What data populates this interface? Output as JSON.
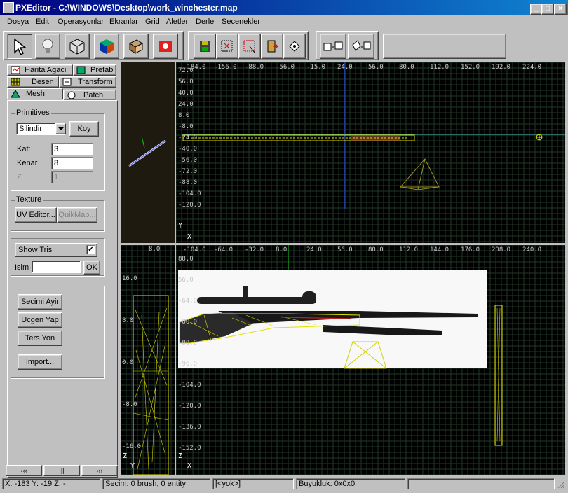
{
  "window": {
    "title": "PXEditor - C:\\WINDOWS\\Desktop\\work_winchester.map",
    "min_label": "_",
    "max_label": "□",
    "close_label": "×"
  },
  "menu": [
    "Dosya",
    "Edit",
    "Operasyonlar",
    "Ekranlar",
    "Grid",
    "Aletler",
    "Derle",
    "Secenekler"
  ],
  "toolbar": {
    "tools": [
      "select-arrow-icon",
      "light-bulb-icon",
      "cube-icon",
      "texture-cube-icon",
      "brush-box-icon",
      "entity-icon",
      "save-disk-icon",
      "select-region-icon",
      "select-box-icon",
      "door-icon",
      "vertex-icon",
      "move-brush-icon",
      "rotate-brush-icon"
    ]
  },
  "tabs": {
    "row1": [
      "Harita Agaci",
      "Prefab"
    ],
    "row2": [
      "Desen",
      "Transform"
    ],
    "row3": [
      "Mesh",
      "Patch"
    ]
  },
  "primitives": {
    "label": "Primitives",
    "shape": "Silindir",
    "koy": "Koy",
    "kat_label": "Kat:",
    "kat_value": "3",
    "kenar_label": "Kenar",
    "kenar_value": "8",
    "z_label": "Z",
    "z_value": "1"
  },
  "texture": {
    "label": "Texture",
    "uv_editor": "UV Editor...",
    "quickmap": "QuikMap..."
  },
  "display": {
    "show_tris": "Show Tris",
    "show_tris_checked": "✔",
    "isim_label": "Isim",
    "isim_value": "",
    "ok": "OK"
  },
  "actions": [
    "Secimi Ayir",
    "Ucgen Yap",
    "Ters Yon",
    "Import..."
  ],
  "nav_buttons": [
    "‹‹‹",
    "|||",
    "›››"
  ],
  "viewports": {
    "top_x_ticks": [
      "-184.0",
      "-156.0",
      "-88.0",
      "-56.0",
      "-15.0",
      "24.0",
      "56.0",
      "80.0",
      "112.0",
      "152.0",
      "192.0",
      "224.0"
    ],
    "top_y_ticks": [
      "72.0",
      "56.0",
      "40.0",
      "24.0",
      "8.0",
      "-8.0",
      "-24.0",
      "-40.0",
      "-56.0",
      "-72.0",
      "-88.0",
      "-104.0",
      "-120.0"
    ],
    "front_x_ticks": [
      "-104.0",
      "-64.0",
      "-32.0",
      "8.0",
      "24.0",
      "56.0",
      "80.0",
      "112.0",
      "144.0",
      "176.0",
      "208.0",
      "240.0"
    ],
    "front_y_ticks": [
      "88.0",
      "56.0",
      "-64.0",
      "-80.0",
      "-88.0",
      "-96.0",
      "-104.0",
      "-120.0",
      "-136.0",
      "-152.0"
    ],
    "side_y_ticks": [
      "16.0",
      "8.0",
      "0.0",
      "-8.0",
      "-16.0"
    ],
    "side_x_ticks": [
      "8.0"
    ],
    "axis_top": "Y",
    "axis_top_x": "X",
    "axis_front": "Z",
    "axis_front_x": "X",
    "axis_side": "Z",
    "axis_side_y": "Y"
  },
  "status": {
    "coords": "X: -183  Y: -19    Z: -",
    "selection": "Secim: 0 brush, 0 entity",
    "entity": "[<yok>]",
    "size": "Buyukluk: 0x0x0"
  }
}
